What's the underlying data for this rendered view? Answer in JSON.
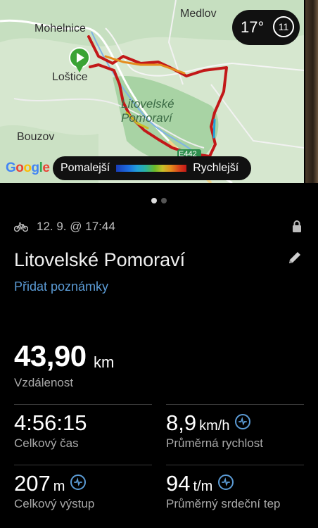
{
  "map": {
    "labels": {
      "medlov": "Medlov",
      "mohelnice": "Mohelnice",
      "lostice": "Loštice",
      "bouzov": "Bouzov",
      "park": "Litovelské\nPomoraví",
      "road": "E442"
    },
    "temperature": "17°",
    "wind": "11",
    "attribution": "Google",
    "legend": {
      "slow": "Pomalejší",
      "fast": "Rychlejší"
    }
  },
  "carousel": {
    "pages": 2,
    "active": 0
  },
  "activity": {
    "date": "12. 9. @ 17:44",
    "title": "Litovelské Pomoraví",
    "add_notes": "Přidat poznámky"
  },
  "stats": {
    "distance": {
      "value": "43,90",
      "unit": "km",
      "label": "Vzdálenost"
    },
    "total_time": {
      "value": "4:56:15",
      "label": "Celkový čas"
    },
    "avg_speed": {
      "value": "8,9",
      "unit": "km/h",
      "label": "Průměrná rychlost"
    },
    "ascent": {
      "value": "207",
      "unit": "m",
      "label": "Celkový výstup"
    },
    "avg_hr": {
      "value": "94",
      "unit": "t/m",
      "label": "Průměrný srdeční tep"
    }
  },
  "colors": {
    "accent": "#5b9bd5",
    "start_marker": "#3aa335",
    "route_slow": "#c21818",
    "route_fast": "#e48c1d"
  }
}
